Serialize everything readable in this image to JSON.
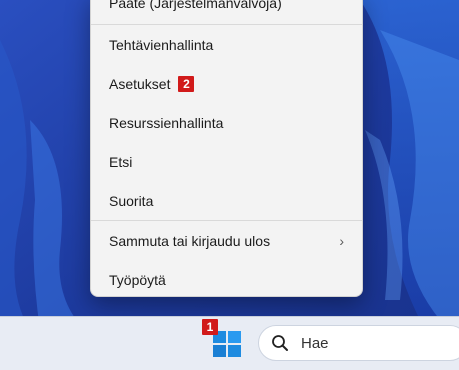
{
  "menu": {
    "items": [
      {
        "label": "Pääte (Järjestelmänvalvoja)"
      },
      {
        "label": "Tehtävienhallinta"
      },
      {
        "label": "Asetukset",
        "badge": "2"
      },
      {
        "label": "Resurssienhallinta"
      },
      {
        "label": "Etsi"
      },
      {
        "label": "Suorita"
      },
      {
        "label": "Sammuta tai kirjaudu ulos",
        "submenu": true
      },
      {
        "label": "Työpöytä"
      }
    ]
  },
  "taskbar": {
    "start_badge": "1",
    "search_placeholder": "Hae"
  },
  "colors": {
    "accent_badge": "#d11a1a",
    "windows_logo": "#1e8be0",
    "wallpaper": "#1f3fa8"
  },
  "icons": [
    "chevron-right-icon",
    "windows-logo-icon",
    "search-icon"
  ]
}
